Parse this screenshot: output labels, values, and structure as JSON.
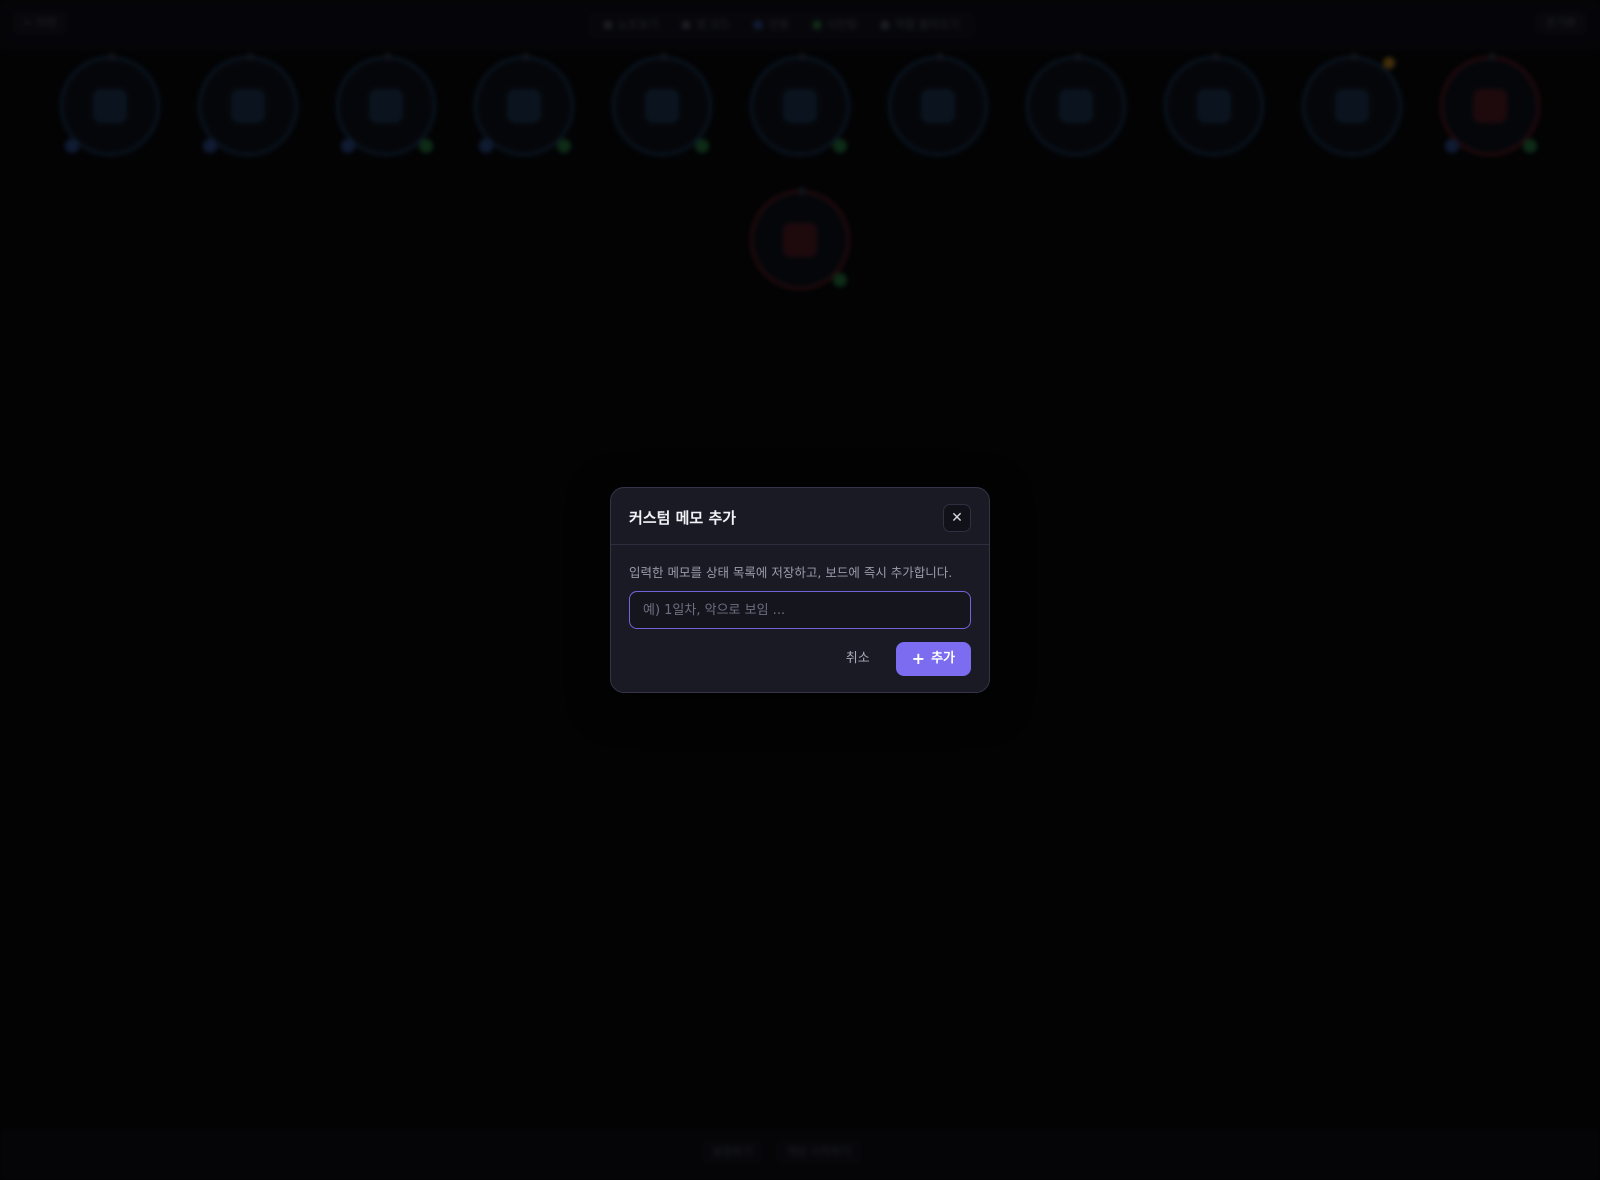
{
  "board": {
    "top_left_label": "← 이전",
    "top_center_items": [
      "노트보기",
      "밤 모드",
      "진영",
      "시민팀",
      "역할 불러오기"
    ],
    "top_right_label": "초기화",
    "bottom_items": [
      "설정하기",
      "게임 시작하기"
    ]
  },
  "modal": {
    "title": "커스텀 메모 추가",
    "close_glyph": "✕",
    "description": "입력한 메모를 상태 목록에 저장하고, 보드에 즉시 추가합니다.",
    "input_placeholder": "예) 1일차, 악으로 보임 ...",
    "input_value": "",
    "cancel_label": "취소",
    "add_icon": "plus-icon",
    "add_label": "추가"
  },
  "colors": {
    "accent": "#7b6cf0",
    "modal_bg": "#1a1a24",
    "page_bg": "#050507",
    "good_ring": "#1b3c5c",
    "evil_ring": "#6a1c22"
  }
}
